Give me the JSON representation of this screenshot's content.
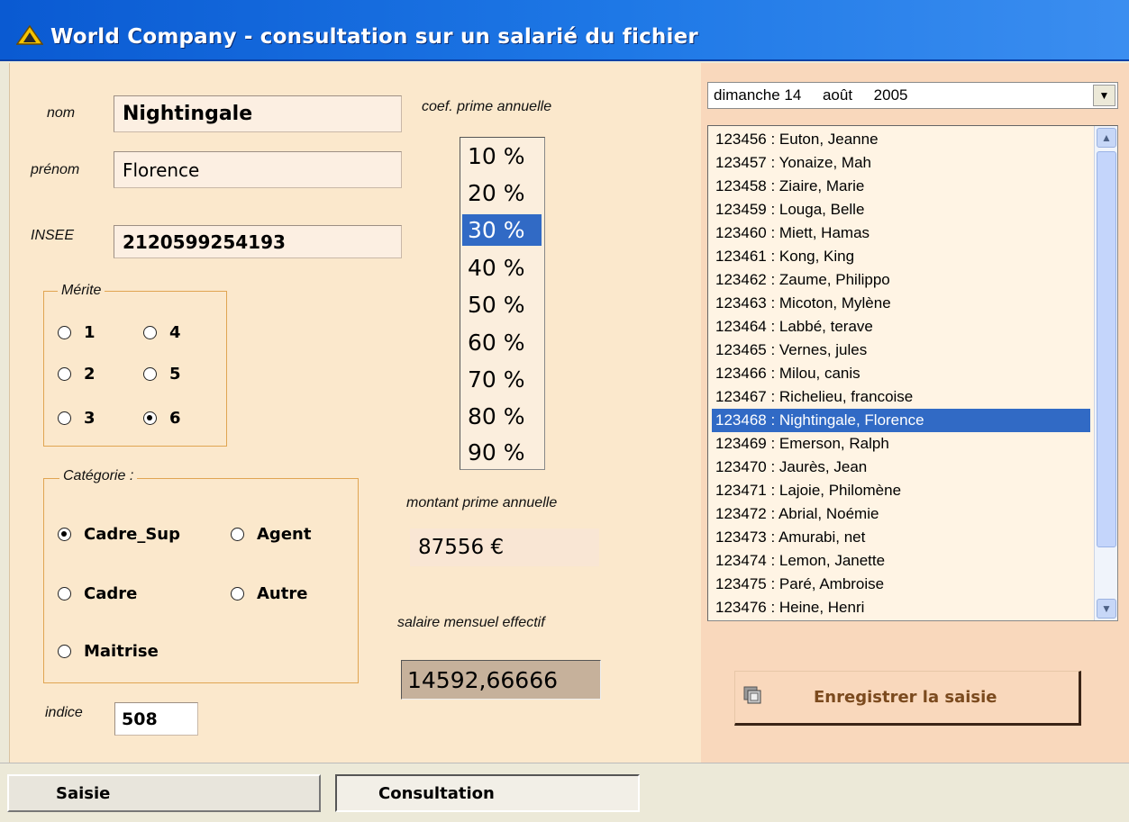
{
  "window": {
    "title": "World Company - consultation sur un salarié du fichier"
  },
  "form": {
    "nom_label": "nom",
    "nom_value": "Nightingale",
    "prenom_label": "prénom",
    "prenom_value": "Florence",
    "insee_label": "INSEE",
    "insee_value": "2120599254193",
    "indice_label": "indice",
    "indice_value": "508"
  },
  "merite": {
    "legend": "Mérite",
    "options": [
      "1",
      "2",
      "3",
      "4",
      "5",
      "6"
    ],
    "selected": "6"
  },
  "categorie": {
    "legend": "Catégorie :",
    "options": [
      "Cadre_Sup",
      "Agent",
      "Cadre",
      "Autre",
      "Maitrise"
    ],
    "selected": "Cadre_Sup"
  },
  "prime": {
    "coef_label": "coef. prime annuelle",
    "coef_options": [
      "10 %",
      "20 %",
      "30 %",
      "40 %",
      "50 %",
      "60 %",
      "70 %",
      "80 %",
      "90 %"
    ],
    "coef_selected": "30 %",
    "montant_label": "montant prime annuelle",
    "montant_value": "87556 €",
    "salaire_label": "salaire mensuel effectif",
    "salaire_value": "14592,66666"
  },
  "date_combo": {
    "value": "dimanche 14     août     2005"
  },
  "employees": {
    "items": [
      "123456 : Euton, Jeanne",
      "123457 : Yonaize, Mah",
      "123458 : Ziaire, Marie",
      "123459 : Louga, Belle",
      "123460 : Miett, Hamas",
      "123461 : Kong, King",
      "123462 : Zaume, Philippo",
      "123463 : Micoton, Mylène",
      "123464 : Labbé, terave",
      "123465 : Vernes, jules",
      "123466 : Milou, canis",
      "123467 : Richelieu, francoise",
      "123468 : Nightingale, Florence",
      "123469 : Emerson, Ralph",
      "123470 : Jaurès, Jean",
      "123471 : Lajoie, Philomène",
      "123472 : Abrial, Noémie",
      "123473 : Amurabi, net",
      "123474 : Lemon, Janette",
      "123475 : Paré, Ambroise",
      "123476 : Heine, Henri"
    ],
    "selected_index": 12
  },
  "buttons": {
    "save_label": "Enregistrer la saisie"
  },
  "tabs": [
    {
      "label": "Saisie",
      "active": false
    },
    {
      "label": "Consultation",
      "active": true
    }
  ],
  "colors": {
    "left_bg": "#fbe8cc",
    "right_bg": "#f9d8bc",
    "selection": "#316ac5",
    "title_bar": "#0a5ad2"
  }
}
